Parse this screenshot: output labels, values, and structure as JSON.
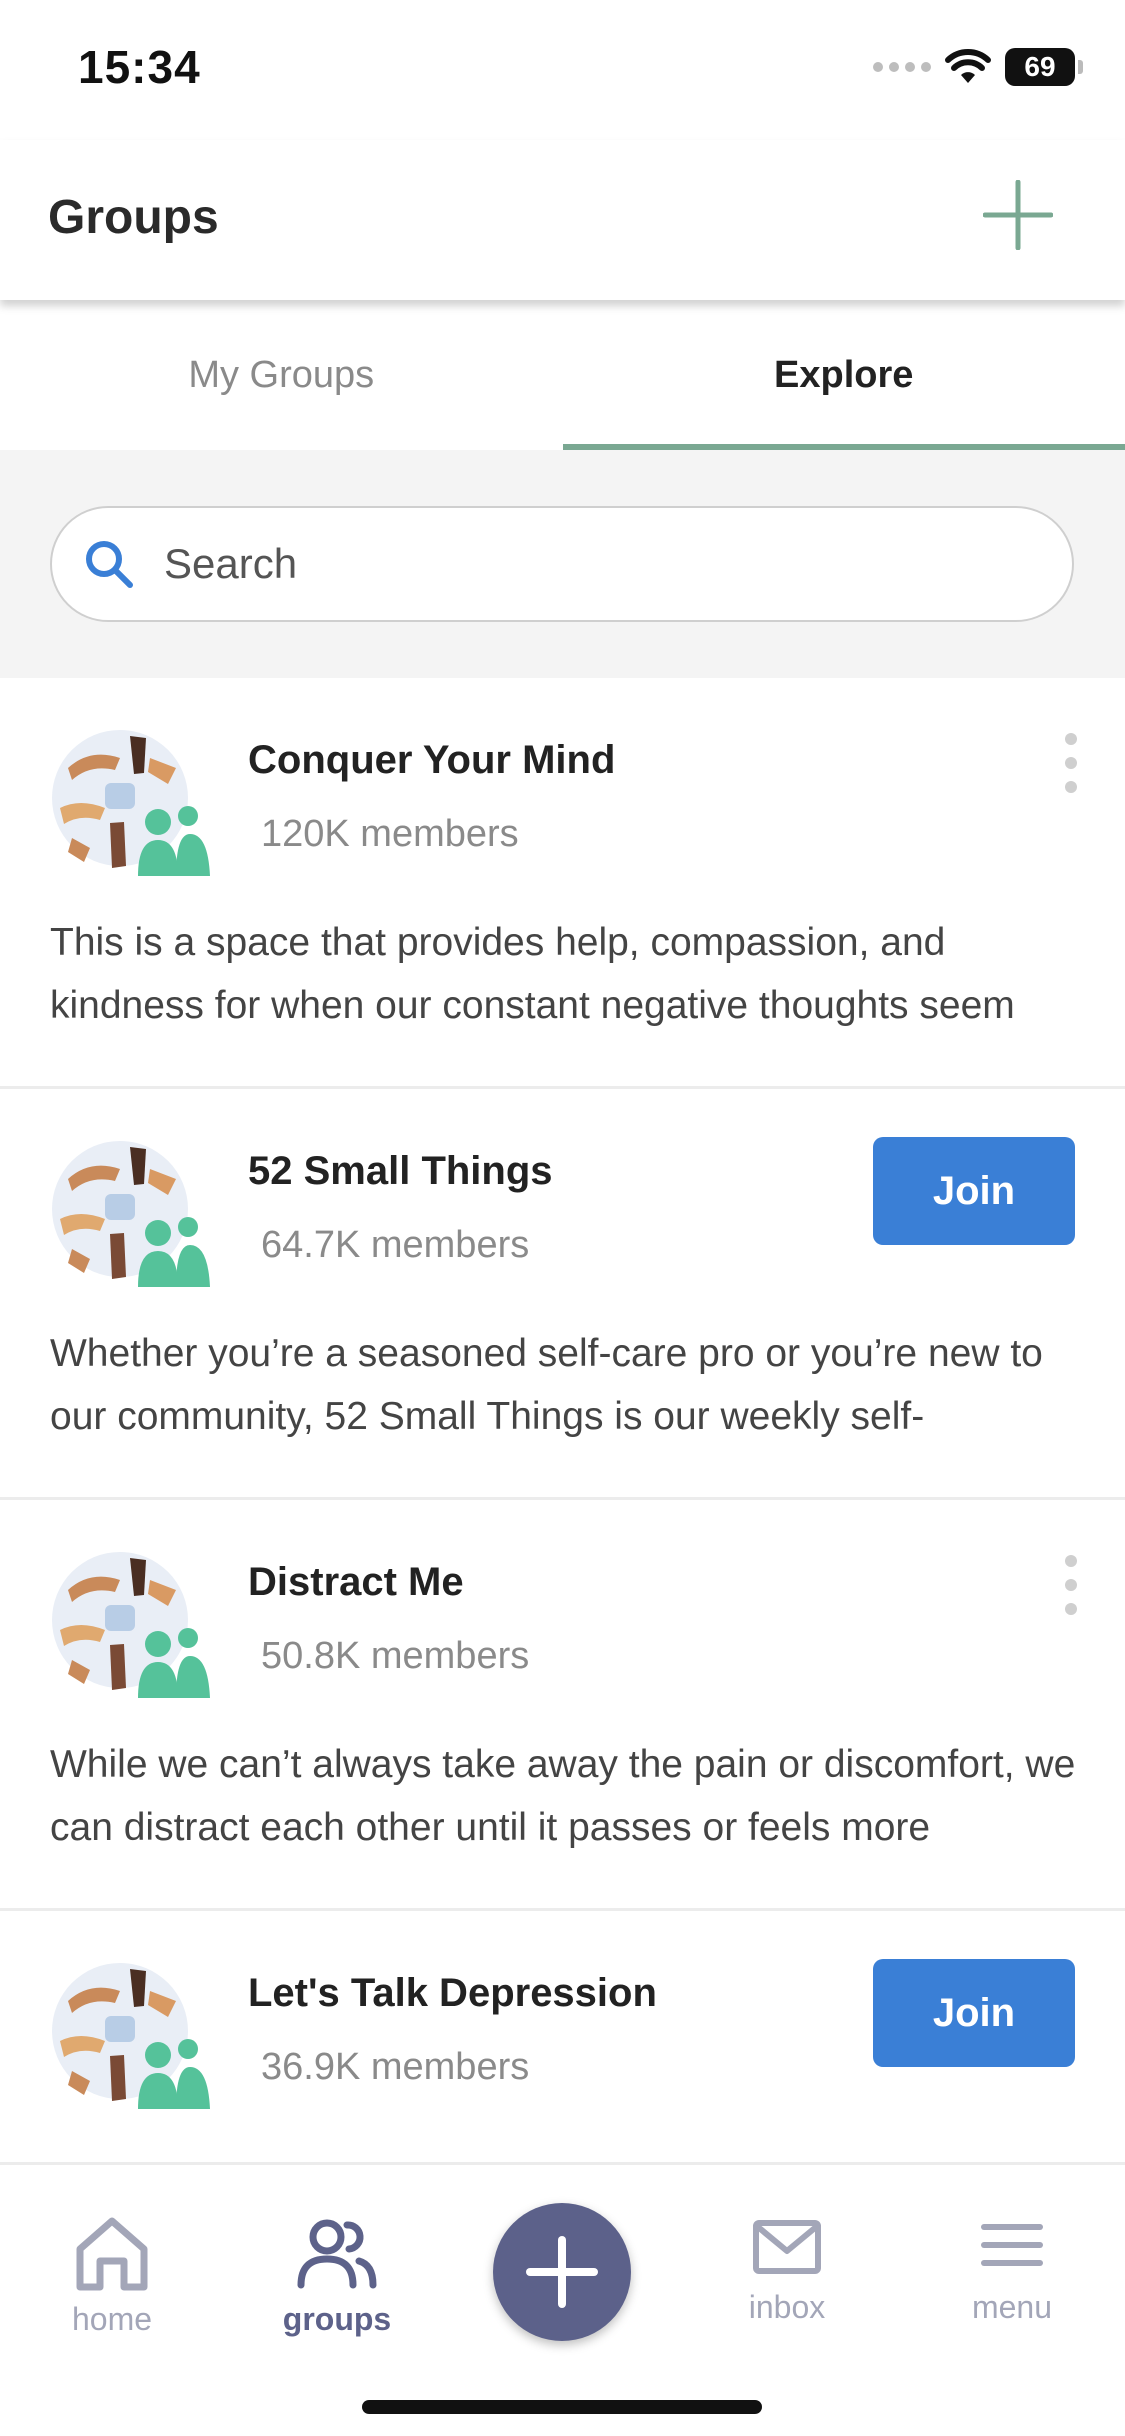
{
  "status_bar": {
    "time": "15:34",
    "battery": "69"
  },
  "header": {
    "title": "Groups"
  },
  "tabs": [
    {
      "label": "My Groups"
    },
    {
      "label": "Explore"
    }
  ],
  "search": {
    "placeholder": "Search"
  },
  "groups": [
    {
      "name": "Conquer Your Mind",
      "members": "120K members",
      "description": "This is a space that provides help, compassion, and kindness for when our constant negative thoughts seem",
      "action": "menu"
    },
    {
      "name": "52 Small Things",
      "members": "64.7K members",
      "description": "Whether you’re a seasoned self-care pro or you’re new to our community, 52 Small Things is our weekly self-",
      "action": "join",
      "join_label": "Join"
    },
    {
      "name": "Distract Me",
      "members": "50.8K members",
      "description": "While we can’t always take away the pain or discomfort, we can distract each other until it passes or feels more",
      "action": "menu"
    },
    {
      "name": "Let's Talk Depression",
      "members": "36.9K members",
      "description": "",
      "action": "join",
      "join_label": "Join"
    }
  ],
  "bottom_nav": {
    "home": "home",
    "groups": "groups",
    "inbox": "inbox",
    "menu": "menu"
  },
  "colors": {
    "accent_green": "#7aa892",
    "join_blue": "#3a7fd6",
    "nav_active": "#5d628a",
    "nav_inactive": "#a3a6b8",
    "fab": "#5c618a"
  },
  "icons": [
    "signal-icon",
    "wifi-icon",
    "battery-icon",
    "plus-icon",
    "search-icon",
    "kebab-icon",
    "home-icon",
    "groups-icon",
    "compose-plus-icon",
    "inbox-icon",
    "menu-icon"
  ]
}
